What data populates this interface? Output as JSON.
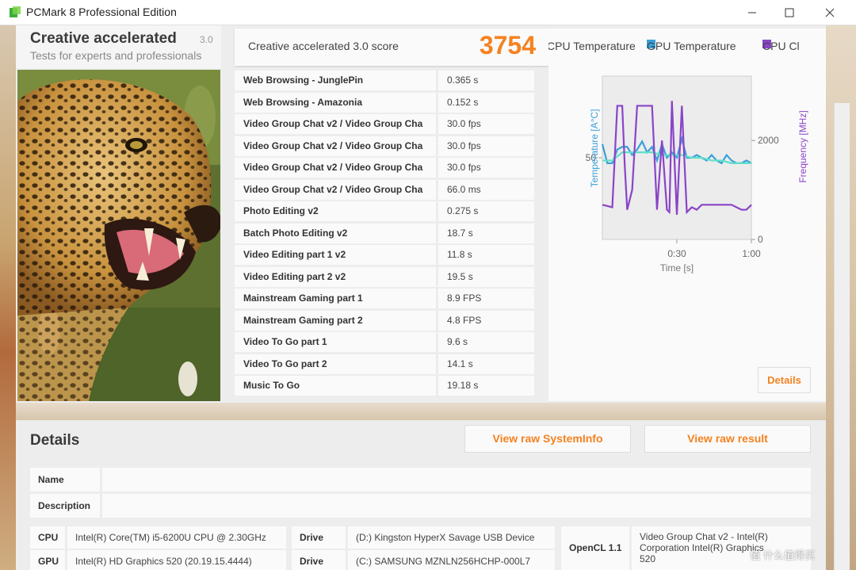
{
  "window": {
    "title": "PCMark 8 Professional Edition"
  },
  "header": {
    "name": "Creative accelerated",
    "version": "3.0",
    "subtitle": "Tests for experts and professionals"
  },
  "score": {
    "label": "Creative accelerated 3.0 score",
    "value": "3754"
  },
  "results": [
    {
      "test": "Web Browsing - JunglePin",
      "value": "0.365 s"
    },
    {
      "test": "Web Browsing - Amazonia",
      "value": "0.152 s"
    },
    {
      "test": "Video Group Chat v2 / Video Group Cha",
      "value": "30.0 fps"
    },
    {
      "test": "Video Group Chat v2 / Video Group Cha",
      "value": "30.0 fps"
    },
    {
      "test": "Video Group Chat v2 / Video Group Cha",
      "value": "30.0 fps"
    },
    {
      "test": "Video Group Chat v2 / Video Group Cha",
      "value": "66.0 ms"
    },
    {
      "test": "Photo Editing v2",
      "value": "0.275 s"
    },
    {
      "test": "Batch Photo Editing v2",
      "value": "18.7 s"
    },
    {
      "test": "Video Editing part 1 v2",
      "value": "11.8 s"
    },
    {
      "test": "Video Editing part 2 v2",
      "value": "19.5 s"
    },
    {
      "test": "Mainstream Gaming part 1",
      "value": "8.9 FPS"
    },
    {
      "test": "Mainstream Gaming part 2",
      "value": "4.8 FPS"
    },
    {
      "test": "Video To Go part 1",
      "value": "9.6 s"
    },
    {
      "test": "Video To Go part 2",
      "value": "14.1 s"
    },
    {
      "test": "Music To Go",
      "value": "19.18 s"
    }
  ],
  "monitor": {
    "legend": [
      {
        "label": "CPU Temperature",
        "color": "#3aa0d8"
      },
      {
        "label": "GPU Temperature",
        "color": "#3aa0d8"
      },
      {
        "label": "CPU Cl",
        "color": "#8a44c8"
      }
    ],
    "details_label": "Details"
  },
  "chart_data": {
    "type": "line",
    "xlabel": "Time [s]",
    "ylabel": "Temperature [A°C]",
    "ylabel_right": "Frequency [MHz]",
    "x_ticks": [
      "0:30",
      "1:00"
    ],
    "y_ticks_left": [
      "50"
    ],
    "y_ticks_right": [
      "2000",
      "0"
    ],
    "xlim": [
      0,
      60
    ],
    "ylim_left": [
      20,
      80
    ],
    "ylim_right": [
      0,
      3300
    ],
    "series": [
      {
        "name": "CPU Temperature",
        "axis": "left",
        "color": "#3aa0d8",
        "x": [
          0,
          2,
          4,
          6,
          8,
          10,
          12,
          14,
          16,
          18,
          20,
          22,
          24,
          26,
          28,
          30,
          32,
          34,
          36,
          38,
          40,
          42,
          44,
          46,
          48,
          50,
          52,
          54,
          56,
          58,
          60
        ],
        "values": [
          55,
          48,
          48,
          53,
          54,
          54,
          51,
          53,
          56,
          52,
          54,
          49,
          55,
          50,
          52,
          50,
          57,
          50,
          50,
          51,
          50,
          49,
          51,
          49,
          48,
          51,
          49,
          48,
          48,
          49,
          48
        ]
      },
      {
        "name": "GPU Temperature",
        "axis": "left",
        "color": "#5fe0c8",
        "x": [
          0,
          4,
          8,
          12,
          16,
          20,
          24,
          28,
          32,
          36,
          40,
          44,
          48,
          52,
          56,
          60
        ],
        "values": [
          49,
          49,
          52,
          52,
          52,
          52,
          51,
          51,
          51,
          50,
          50,
          49,
          49,
          48,
          48,
          48
        ]
      },
      {
        "name": "CPU Clock",
        "axis": "right",
        "color": "#8a44c8",
        "x": [
          0,
          4,
          6,
          8,
          9,
          10,
          12,
          14,
          16,
          18,
          20,
          22,
          24,
          26,
          27,
          28,
          30,
          32,
          34,
          36,
          38,
          40,
          44,
          48,
          52,
          56,
          58,
          60
        ],
        "values": [
          700,
          650,
          2700,
          2700,
          1500,
          600,
          1000,
          2700,
          2700,
          2700,
          2700,
          600,
          2000,
          600,
          550,
          2800,
          500,
          2700,
          550,
          650,
          600,
          700,
          700,
          700,
          700,
          600,
          600,
          700
        ]
      }
    ]
  },
  "details": {
    "title": "Details",
    "view_systeminfo": "View raw SystemInfo",
    "view_result": "View raw result",
    "name_label": "Name",
    "name_value": "",
    "description_label": "Description",
    "description_value": "",
    "cpu_label": "CPU",
    "cpu_value": "Intel(R) Core(TM) i5-6200U CPU @ 2.30GHz",
    "gpu_label": "GPU",
    "gpu_value": "Intel(R) HD Graphics 520 (20.19.15.4444)",
    "drive1_label": "Drive",
    "drive1_value": "(D:) Kingston HyperX Savage USB Device",
    "drive2_label": "Drive",
    "drive2_value": "(C:) SAMSUNG MZNLN256HCHP-000L7",
    "opencl_label": "OpenCL 1.1",
    "opencl_value_line1": "Video Group Chat v2 - Intel(R)",
    "opencl_value_line2": "Corporation Intel(R) Graphics",
    "opencl_value_line3": "520"
  },
  "watermark": "值 什么值得买"
}
